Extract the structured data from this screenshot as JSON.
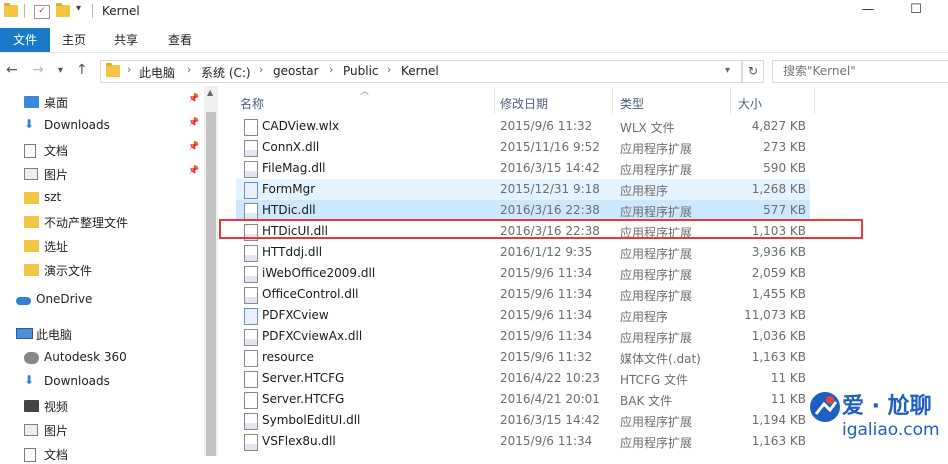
{
  "window": {
    "title": "Kernel",
    "minimize": "—",
    "maximize": "☐"
  },
  "ribbon": {
    "tabs": [
      "文件",
      "主页",
      "共享",
      "查看"
    ]
  },
  "address": {
    "crumbs": [
      "此电脑",
      "系统 (C:)",
      "geostar",
      "Public",
      "Kernel"
    ],
    "search_placeholder": "搜索\"Kernel\""
  },
  "nav": {
    "items": [
      {
        "label": "桌面",
        "icon": "desktop-icon",
        "pinned": true
      },
      {
        "label": "Downloads",
        "icon": "download-icon",
        "pinned": true
      },
      {
        "label": "文档",
        "icon": "document-icon",
        "pinned": true
      },
      {
        "label": "图片",
        "icon": "picture-icon",
        "pinned": true
      },
      {
        "label": "szt",
        "icon": "folder-icon",
        "pinned": false
      },
      {
        "label": "不动产整理文件",
        "icon": "folder-icon",
        "pinned": false
      },
      {
        "label": "选址",
        "icon": "folder-icon",
        "pinned": false
      },
      {
        "label": "演示文件",
        "icon": "folder-icon",
        "pinned": false
      },
      {
        "label": "OneDrive",
        "icon": "cloud-icon",
        "pinned": false
      },
      {
        "label": "此电脑",
        "icon": "computer-icon",
        "pinned": false
      },
      {
        "label": "Autodesk 360",
        "icon": "autodesk-icon",
        "pinned": false
      },
      {
        "label": "Downloads",
        "icon": "download-icon",
        "pinned": false
      },
      {
        "label": "视频",
        "icon": "video-icon",
        "pinned": false
      },
      {
        "label": "图片",
        "icon": "picture-icon",
        "pinned": false
      },
      {
        "label": "文档",
        "icon": "document-icon",
        "pinned": false
      }
    ]
  },
  "columns": {
    "name": "名称",
    "date": "修改日期",
    "type": "类型",
    "size": "大小"
  },
  "files": [
    {
      "name": "CADView.wlx",
      "date": "2015/9/6 11:32",
      "type": "WLX 文件",
      "size": "4,827 KB",
      "icon": "file-icon"
    },
    {
      "name": "ConnX.dll",
      "date": "2015/11/16 9:52",
      "type": "应用程序扩展",
      "size": "273 KB",
      "icon": "dll-icon"
    },
    {
      "name": "FileMag.dll",
      "date": "2016/3/15 14:42",
      "type": "应用程序扩展",
      "size": "590 KB",
      "icon": "dll-icon"
    },
    {
      "name": "FormMgr",
      "date": "2015/12/31 9:18",
      "type": "应用程序",
      "size": "1,268 KB",
      "icon": "exe-icon",
      "state": "hl"
    },
    {
      "name": "HTDic.dll",
      "date": "2016/3/16 22:38",
      "type": "应用程序扩展",
      "size": "577 KB",
      "icon": "dll-icon",
      "state": "sel"
    },
    {
      "name": "HTDicUI.dll",
      "date": "2016/3/16 22:38",
      "type": "应用程序扩展",
      "size": "1,103 KB",
      "icon": "dll-icon"
    },
    {
      "name": "HTTddj.dll",
      "date": "2016/1/12 9:35",
      "type": "应用程序扩展",
      "size": "3,936 KB",
      "icon": "dll-icon"
    },
    {
      "name": "iWebOffice2009.dll",
      "date": "2015/9/6 11:34",
      "type": "应用程序扩展",
      "size": "2,059 KB",
      "icon": "dll-icon"
    },
    {
      "name": "OfficeControl.dll",
      "date": "2015/9/6 11:34",
      "type": "应用程序扩展",
      "size": "1,455 KB",
      "icon": "dll-icon"
    },
    {
      "name": "PDFXCview",
      "date": "2015/9/6 11:34",
      "type": "应用程序",
      "size": "11,073 KB",
      "icon": "exe-icon"
    },
    {
      "name": "PDFXCviewAx.dll",
      "date": "2015/9/6 11:34",
      "type": "应用程序扩展",
      "size": "1,036 KB",
      "icon": "dll-icon"
    },
    {
      "name": "resource",
      "date": "2015/9/6 11:32",
      "type": "媒体文件(.dat)",
      "size": "1,163 KB",
      "icon": "file-icon"
    },
    {
      "name": "Server.HTCFG",
      "date": "2016/4/22 10:23",
      "type": "HTCFG 文件",
      "size": "11 KB",
      "icon": "file-icon"
    },
    {
      "name": "Server.HTCFG",
      "date": "2016/4/21 20:01",
      "type": "BAK 文件",
      "size": "11 KB",
      "icon": "file-icon"
    },
    {
      "name": "SymbolEditUI.dll",
      "date": "2016/3/15 14:42",
      "type": "应用程序扩展",
      "size": "1,194 KB",
      "icon": "dll-icon"
    },
    {
      "name": "VSFlex8u.dll",
      "date": "2015/9/6 11:34",
      "type": "应用程序扩展",
      "size": "1,163 KB",
      "icon": "dll-icon"
    }
  ],
  "highlight_row": 5,
  "watermark": {
    "cn": "爱 · 尬聊",
    "url": "igaliao.com"
  },
  "colors": {
    "accent": "#1979ca",
    "selected": "#cce8ff",
    "highlight": "#e5f3ff",
    "redbox": "#e23a3a"
  }
}
